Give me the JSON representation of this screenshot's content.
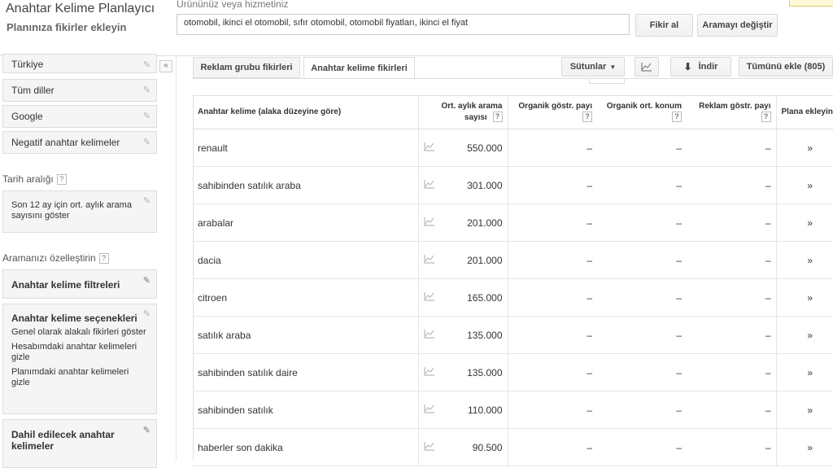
{
  "header": {
    "title": "Anahtar Kelime Planlayıcı",
    "subtitle": "Planınıza fikirler ekleyin",
    "product_label": "Ürününüz veya hizmetiniz",
    "keyword_value": "otomobil, ikinci el otomobil, sıfır otomobil, otomobil fiyatları, ikinci el fiyat",
    "get_ideas": "Fikir al",
    "change_search": "Aramayı değiştir"
  },
  "sidebar": {
    "targeting": [
      "Türkiye",
      "Tüm diller",
      "Google",
      "Negatif anahtar kelimeler"
    ],
    "collapse": "«",
    "date_range_heading": "Tarih aralığı",
    "date_range_value": "Son 12 ay için ort. aylık arama sayısını göster",
    "customize_heading": "Aramanızı özelleştirin",
    "keyword_filters": "Anahtar kelime filtreleri",
    "keyword_options_title": "Anahtar kelime seçenekleri",
    "keyword_options": [
      "Genel olarak alakalı fikirleri göster",
      "Hesabımdaki anahtar kelimeleri gizle",
      "Planımdaki anahtar kelimeleri gizle"
    ],
    "include_keywords": "Dahil edilecek anahtar kelimeler",
    "help": "?"
  },
  "tabs": [
    "Reklam grubu fikirleri",
    "Anahtar kelime fikirleri"
  ],
  "toolbar": {
    "columns": "Sütunlar",
    "download": "İndir",
    "add_all": "Tümünü ekle (805)"
  },
  "table": {
    "headers": {
      "keyword": "Anahtar kelime (alaka düzeyine göre)",
      "avg_searches": "Ort. aylık arama sayısı",
      "organic_share": "Organik göstr. payı",
      "organic_position": "Organik ort. konum",
      "ad_share": "Reklam göstr. payı",
      "add_to_plan": "Plana ekleyin"
    },
    "rows": [
      {
        "keyword": "renault",
        "searches": "550.000",
        "organic_share": "–",
        "organic_position": "–",
        "ad_share": "–"
      },
      {
        "keyword": "sahibinden satılık araba",
        "searches": "301.000",
        "organic_share": "–",
        "organic_position": "–",
        "ad_share": "–"
      },
      {
        "keyword": "arabalar",
        "searches": "201.000",
        "organic_share": "–",
        "organic_position": "–",
        "ad_share": "–"
      },
      {
        "keyword": "dacia",
        "searches": "201.000",
        "organic_share": "–",
        "organic_position": "–",
        "ad_share": "–"
      },
      {
        "keyword": "citroen",
        "searches": "165.000",
        "organic_share": "–",
        "organic_position": "–",
        "ad_share": "–"
      },
      {
        "keyword": "satılık araba",
        "searches": "135.000",
        "organic_share": "–",
        "organic_position": "–",
        "ad_share": "–"
      },
      {
        "keyword": "sahibinden satılık daire",
        "searches": "135.000",
        "organic_share": "–",
        "organic_position": "–",
        "ad_share": "–"
      },
      {
        "keyword": "sahibinden satılık",
        "searches": "110.000",
        "organic_share": "–",
        "organic_position": "–",
        "ad_share": "–"
      },
      {
        "keyword": "haberler son dakika",
        "searches": "90.500",
        "organic_share": "–",
        "organic_position": "–",
        "ad_share": "–"
      }
    ],
    "add_symbol": "»"
  },
  "icons": {
    "pencil": "pencil-icon",
    "trend": "trend-chart-icon",
    "download": "download-icon",
    "dropdown": "caret-down-icon"
  }
}
